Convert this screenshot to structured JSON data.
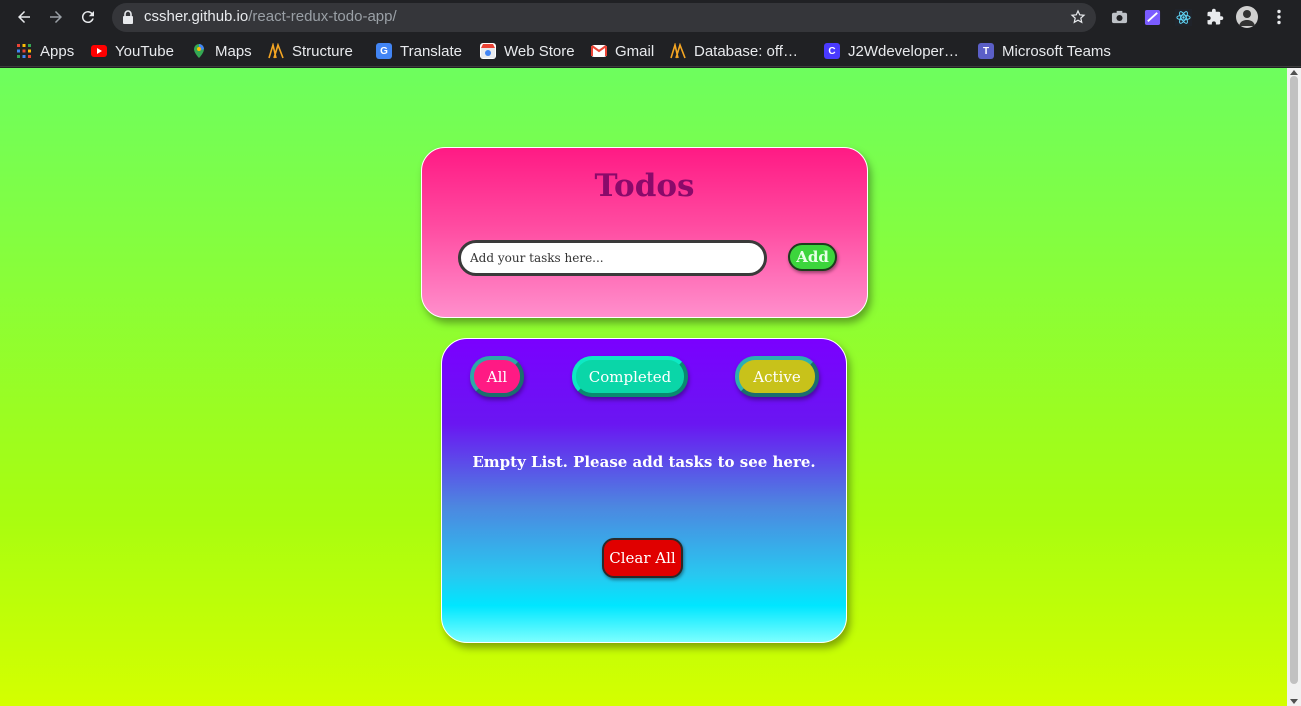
{
  "browser": {
    "url_host": "cssher.github.io",
    "url_path": "/react-redux-todo-app/",
    "bookmarks": [
      {
        "label": "Apps",
        "icon": "apps-grid-icon"
      },
      {
        "label": "YouTube",
        "icon": "youtube-icon"
      },
      {
        "label": "Maps",
        "icon": "maps-icon"
      },
      {
        "label": "Structure",
        "icon": "structure-icon"
      },
      {
        "label": "Translate",
        "icon": "translate-icon"
      },
      {
        "label": "Web Store",
        "icon": "webstore-icon"
      },
      {
        "label": "Gmail",
        "icon": "gmail-icon"
      },
      {
        "label": "Database: off…",
        "icon": "database-icon"
      },
      {
        "label": "J2Wdeveloper…",
        "icon": "j2w-icon"
      },
      {
        "label": "Microsoft Teams",
        "icon": "teams-icon"
      }
    ]
  },
  "app": {
    "title": "Todos",
    "input_placeholder": "Add your tasks here...",
    "input_value": "",
    "add_label": "Add",
    "filters": {
      "all": "All",
      "completed": "Completed",
      "active": "Active"
    },
    "empty_message": "Empty List. Please add tasks to see here.",
    "clear_label": "Clear All"
  },
  "colors": {
    "page_top": "#6dfe5e",
    "page_bottom": "#d4ff00",
    "header_card": "#ff4aa0",
    "list_card_top": "#7a00ff",
    "list_card_bottom": "#00e6ff",
    "add_button": "#3cd53c",
    "clear_button": "#e00000"
  }
}
